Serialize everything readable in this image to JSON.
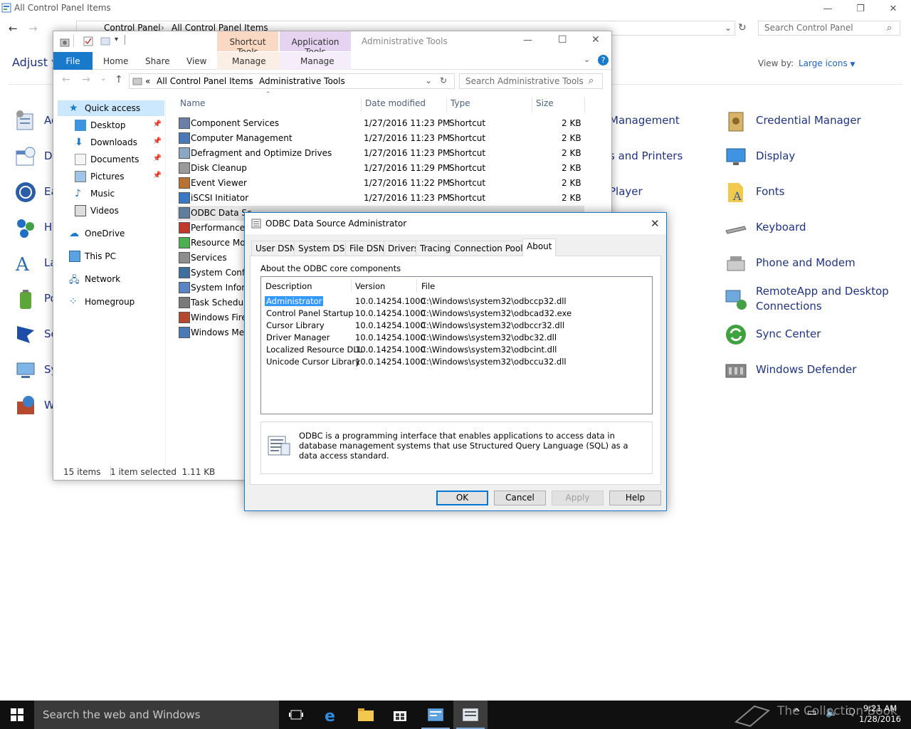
{
  "control_panel": {
    "title": "All Control Panel Items",
    "breadcrumb": [
      "Control Panel",
      "All Control Panel Items"
    ],
    "search_placeholder": "Search Control Panel",
    "heading": "Adjust y",
    "view_by_label": "View by:",
    "view_by_value": "Large icons",
    "left_items": [
      "Ad",
      "Da",
      "Ea",
      "Ho",
      "La",
      "Po",
      "Se",
      "Sy",
      "Wi"
    ],
    "middle_items": [
      "Management",
      "s and Printers",
      "Player"
    ],
    "right_items": [
      "Credential Manager",
      "Display",
      "Fonts",
      "Keyboard",
      "Phone and Modem",
      "RemoteApp and Desktop",
      "Connections",
      "Sync Center",
      "Windows Defender"
    ]
  },
  "explorer": {
    "title": "Administrative Tools",
    "context_tabs": [
      "Shortcut Tools",
      "Application Tools"
    ],
    "ribbon_tabs": [
      "File",
      "Home",
      "Share",
      "View",
      "Manage",
      "Manage"
    ],
    "path": [
      "All Control Panel Items",
      "Administrative Tools"
    ],
    "path_prefix": "«",
    "search_placeholder": "Search Administrative Tools",
    "nav": [
      "Quick access",
      "Desktop",
      "Downloads",
      "Documents",
      "Pictures",
      "Music",
      "Videos",
      "OneDrive",
      "This PC",
      "Network",
      "Homegroup"
    ],
    "columns": [
      "Name",
      "Date modified",
      "Type",
      "Size"
    ],
    "files": [
      {
        "name": "Component Services",
        "date": "1/27/2016 11:23 PM",
        "type": "Shortcut",
        "size": "2 KB"
      },
      {
        "name": "Computer Management",
        "date": "1/27/2016 11:23 PM",
        "type": "Shortcut",
        "size": "2 KB"
      },
      {
        "name": "Defragment and Optimize Drives",
        "date": "1/27/2016 11:23 PM",
        "type": "Shortcut",
        "size": "2 KB"
      },
      {
        "name": "Disk Cleanup",
        "date": "1/27/2016 11:29 PM",
        "type": "Shortcut",
        "size": "2 KB"
      },
      {
        "name": "Event Viewer",
        "date": "1/27/2016 11:22 PM",
        "type": "Shortcut",
        "size": "2 KB"
      },
      {
        "name": "iSCSI Initiator",
        "date": "1/27/2016 11:23 PM",
        "type": "Shortcut",
        "size": "2 KB"
      },
      {
        "name": "ODBC Data Sc",
        "date": "",
        "type": "",
        "size": ""
      },
      {
        "name": "Performance",
        "date": "",
        "type": "",
        "size": ""
      },
      {
        "name": "Resource Mo",
        "date": "",
        "type": "",
        "size": ""
      },
      {
        "name": "Services",
        "date": "",
        "type": "",
        "size": ""
      },
      {
        "name": "System Confi",
        "date": "",
        "type": "",
        "size": ""
      },
      {
        "name": "System Infor",
        "date": "",
        "type": "",
        "size": ""
      },
      {
        "name": "Task Schedule",
        "date": "",
        "type": "",
        "size": ""
      },
      {
        "name": "Windows Fire",
        "date": "",
        "type": "",
        "size": ""
      },
      {
        "name": "Windows Me",
        "date": "",
        "type": "",
        "size": ""
      }
    ],
    "status_count": "15 items",
    "status_selected": "1 item selected  1.11 KB"
  },
  "dialog": {
    "title": "ODBC Data Source Administrator",
    "tabs": [
      "User DSN",
      "System DSN",
      "File DSN",
      "Drivers",
      "Tracing",
      "Connection Pooling",
      "About"
    ],
    "active_tab": "About",
    "section_label": "About the ODBC core components",
    "columns": [
      "Description",
      "Version",
      "File"
    ],
    "rows": [
      {
        "desc": "Administrator",
        "version": "10.0.14254.1000",
        "file": "C:\\Windows\\system32\\odbccp32.dll"
      },
      {
        "desc": "Control Panel Startup",
        "version": "10.0.14254.1000",
        "file": "C:\\Windows\\system32\\odbcad32.exe"
      },
      {
        "desc": "Cursor Library",
        "version": "10.0.14254.1000",
        "file": "C:\\Windows\\system32\\odbccr32.dll"
      },
      {
        "desc": "Driver Manager",
        "version": "10.0.14254.1000",
        "file": "C:\\Windows\\system32\\odbc32.dll"
      },
      {
        "desc": "Localized Resource DLL",
        "version": "10.0.14254.1000",
        "file": "C:\\Windows\\system32\\odbcint.dll"
      },
      {
        "desc": "Unicode Cursor Library",
        "version": "10.0.14254.1000",
        "file": "C:\\Windows\\system32\\odbccu32.dll"
      }
    ],
    "info_text": "ODBC is a programming interface that enables applications to access data in database management systems that use Structured Query Language (SQL) as a data access standard.",
    "buttons": [
      "OK",
      "Cancel",
      "Apply",
      "Help"
    ]
  },
  "taskbar": {
    "search_placeholder": "Search the web and Windows",
    "time": "9:21 AM",
    "date": "1/28/2016",
    "watermark": "The Collection Book"
  }
}
